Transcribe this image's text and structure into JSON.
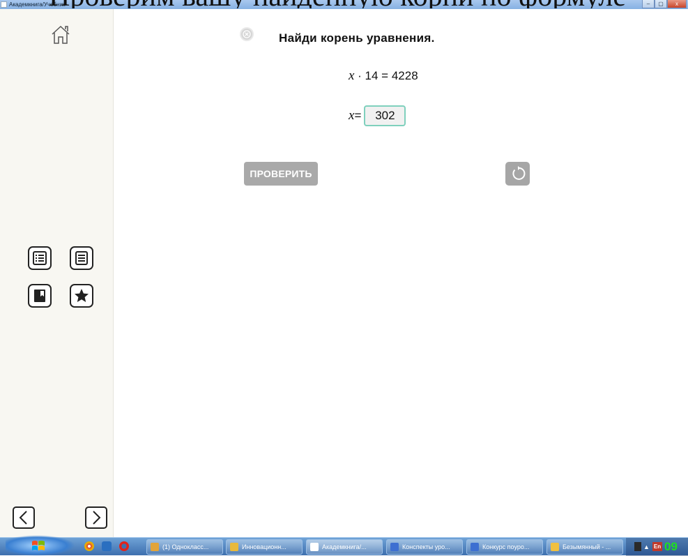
{
  "caption_overlay": "Проверим вашу найденную корни по формуле",
  "window": {
    "title": "Академкнига/Учебник",
    "buttons": [
      "–",
      "▢",
      "x"
    ]
  },
  "sidebar": {
    "home_icon": "home-icon",
    "tools": [
      {
        "name": "contents-list-icon"
      },
      {
        "name": "page-text-icon"
      },
      {
        "name": "bookmark-icon"
      },
      {
        "name": "favorites-star-icon"
      }
    ],
    "prev_icon": "chevron-left-icon",
    "next_icon": "chevron-right-icon"
  },
  "task": {
    "title": "Найди корень уравнения.",
    "equation_var": "x",
    "equation_rest": " · 14 = 4228",
    "answer_label": "=",
    "answer_value": "302",
    "check_label": "ПРОВЕРИТЬ"
  },
  "taskbar": {
    "items": [
      {
        "label": "(1) Однокласс...",
        "color": "#e2a43a"
      },
      {
        "label": "Инновационн...",
        "color": "#e8b93b"
      },
      {
        "label": "Академкнига/...",
        "color": "#ffffff"
      },
      {
        "label": "Конспекты уро...",
        "color": "#3d6fd1"
      },
      {
        "label": "Конкурс поуро...",
        "color": "#3d6fd1"
      },
      {
        "label": "Безымянный - ...",
        "color": "#f0c040"
      }
    ],
    "lang": "En",
    "clock": "09"
  },
  "colors": {
    "accent_border": "#7fd0bd",
    "button_gray": "#a9a9a9",
    "sidebar_bg": "#f8f7f2"
  }
}
